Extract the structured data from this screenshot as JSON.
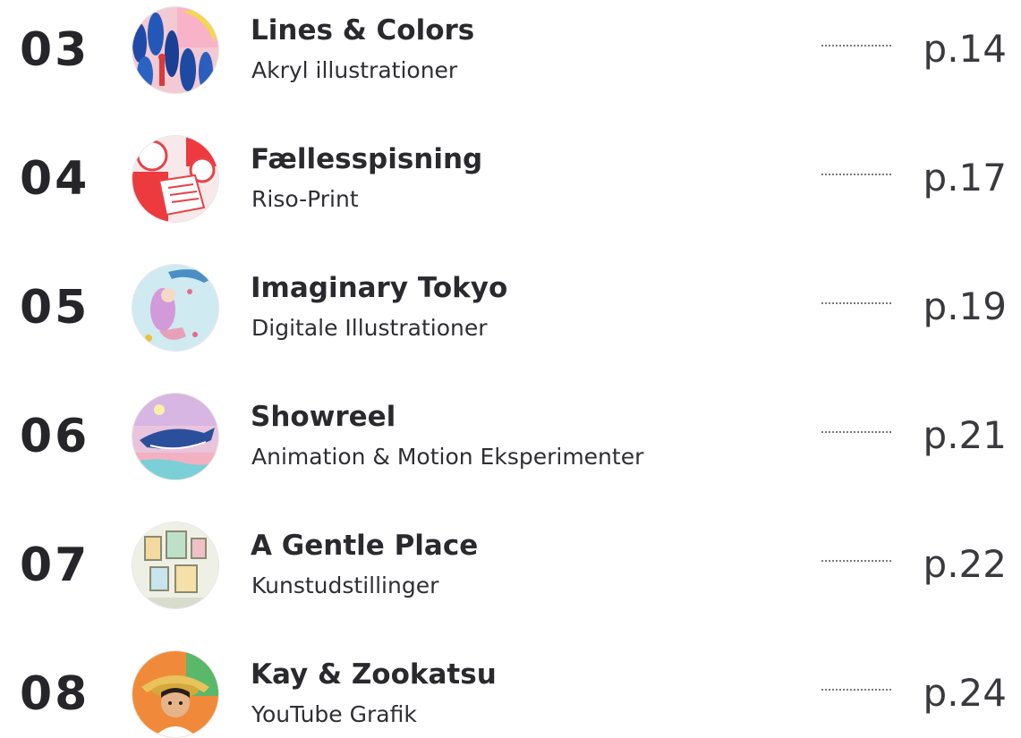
{
  "toc": {
    "entries": [
      {
        "number": "03",
        "title": "Lines & Colors",
        "subtitle": "Akryl illustrationer",
        "page": "p.14",
        "thumbnail": "acrylic-illustration-thumbnail"
      },
      {
        "number": "04",
        "title": "Fællesspisning",
        "subtitle": "Riso-Print",
        "page": "p.17",
        "thumbnail": "riso-print-thumbnail"
      },
      {
        "number": "05",
        "title": "Imaginary Tokyo",
        "subtitle": "Digitale Illustrationer",
        "page": "p.19",
        "thumbnail": "digital-illustration-thumbnail"
      },
      {
        "number": "06",
        "title": "Showreel",
        "subtitle": "Animation & Motion Eksperimenter",
        "page": "p.21",
        "thumbnail": "whale-animation-thumbnail"
      },
      {
        "number": "07",
        "title": "A Gentle Place",
        "subtitle": "Kunstudstillinger",
        "page": "p.22",
        "thumbnail": "exhibition-wall-thumbnail"
      },
      {
        "number": "08",
        "title": "Kay & Zookatsu",
        "subtitle": "YouTube Grafik",
        "page": "p.24",
        "thumbnail": "portrait-thumbnail"
      }
    ]
  },
  "colors": {
    "text": "#2a2a2e",
    "leader": "#7a7a7a",
    "background": "#ffffff"
  }
}
